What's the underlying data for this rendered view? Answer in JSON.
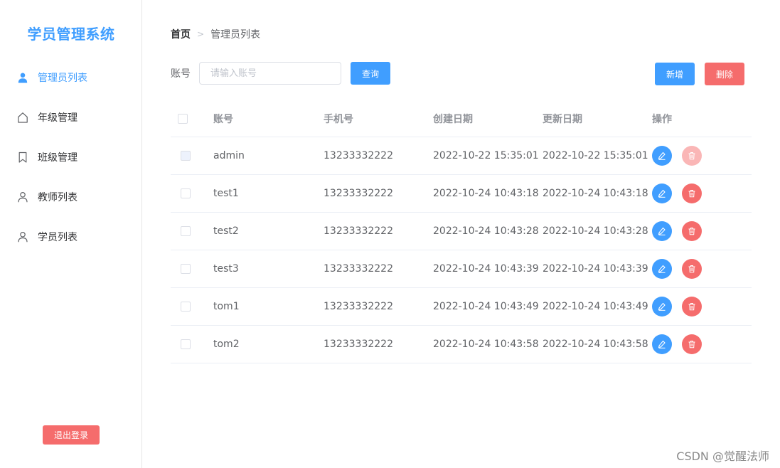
{
  "sidebar": {
    "logo": "学员管理系统",
    "items": [
      {
        "label": "管理员列表",
        "icon": "user-filled-icon",
        "active": true
      },
      {
        "label": "年级管理",
        "icon": "home-icon",
        "active": false
      },
      {
        "label": "班级管理",
        "icon": "bookmark-icon",
        "active": false
      },
      {
        "label": "教师列表",
        "icon": "user-icon",
        "active": false
      },
      {
        "label": "学员列表",
        "icon": "user-icon",
        "active": false
      }
    ],
    "logout_label": "退出登录"
  },
  "breadcrumb": {
    "home": "首页",
    "separator": ">",
    "current": "管理员列表"
  },
  "search": {
    "label": "账号",
    "placeholder": "请输入账号",
    "value": "",
    "query_label": "查询"
  },
  "toolbar": {
    "add_label": "新增",
    "delete_label": "删除"
  },
  "table": {
    "columns": [
      "账号",
      "手机号",
      "创建日期",
      "更新日期",
      "操作"
    ],
    "rows": [
      {
        "account": "admin",
        "phone": "13233332222",
        "created": "2022-10-22 15:35:01",
        "updated": "2022-10-22 15:35:01",
        "disabled": true
      },
      {
        "account": "test1",
        "phone": "13233332222",
        "created": "2022-10-24 10:43:18",
        "updated": "2022-10-24 10:43:18",
        "disabled": false
      },
      {
        "account": "test2",
        "phone": "13233332222",
        "created": "2022-10-24 10:43:28",
        "updated": "2022-10-24 10:43:28",
        "disabled": false
      },
      {
        "account": "test3",
        "phone": "13233332222",
        "created": "2022-10-24 10:43:39",
        "updated": "2022-10-24 10:43:39",
        "disabled": false
      },
      {
        "account": "tom1",
        "phone": "13233332222",
        "created": "2022-10-24 10:43:49",
        "updated": "2022-10-24 10:43:49",
        "disabled": false
      },
      {
        "account": "tom2",
        "phone": "13233332222",
        "created": "2022-10-24 10:43:58",
        "updated": "2022-10-24 10:43:58",
        "disabled": false
      }
    ]
  },
  "watermark": "CSDN @觉醒法师",
  "colors": {
    "primary": "#409eff",
    "danger": "#f56c6c",
    "danger_disabled": "#fab6b6"
  }
}
